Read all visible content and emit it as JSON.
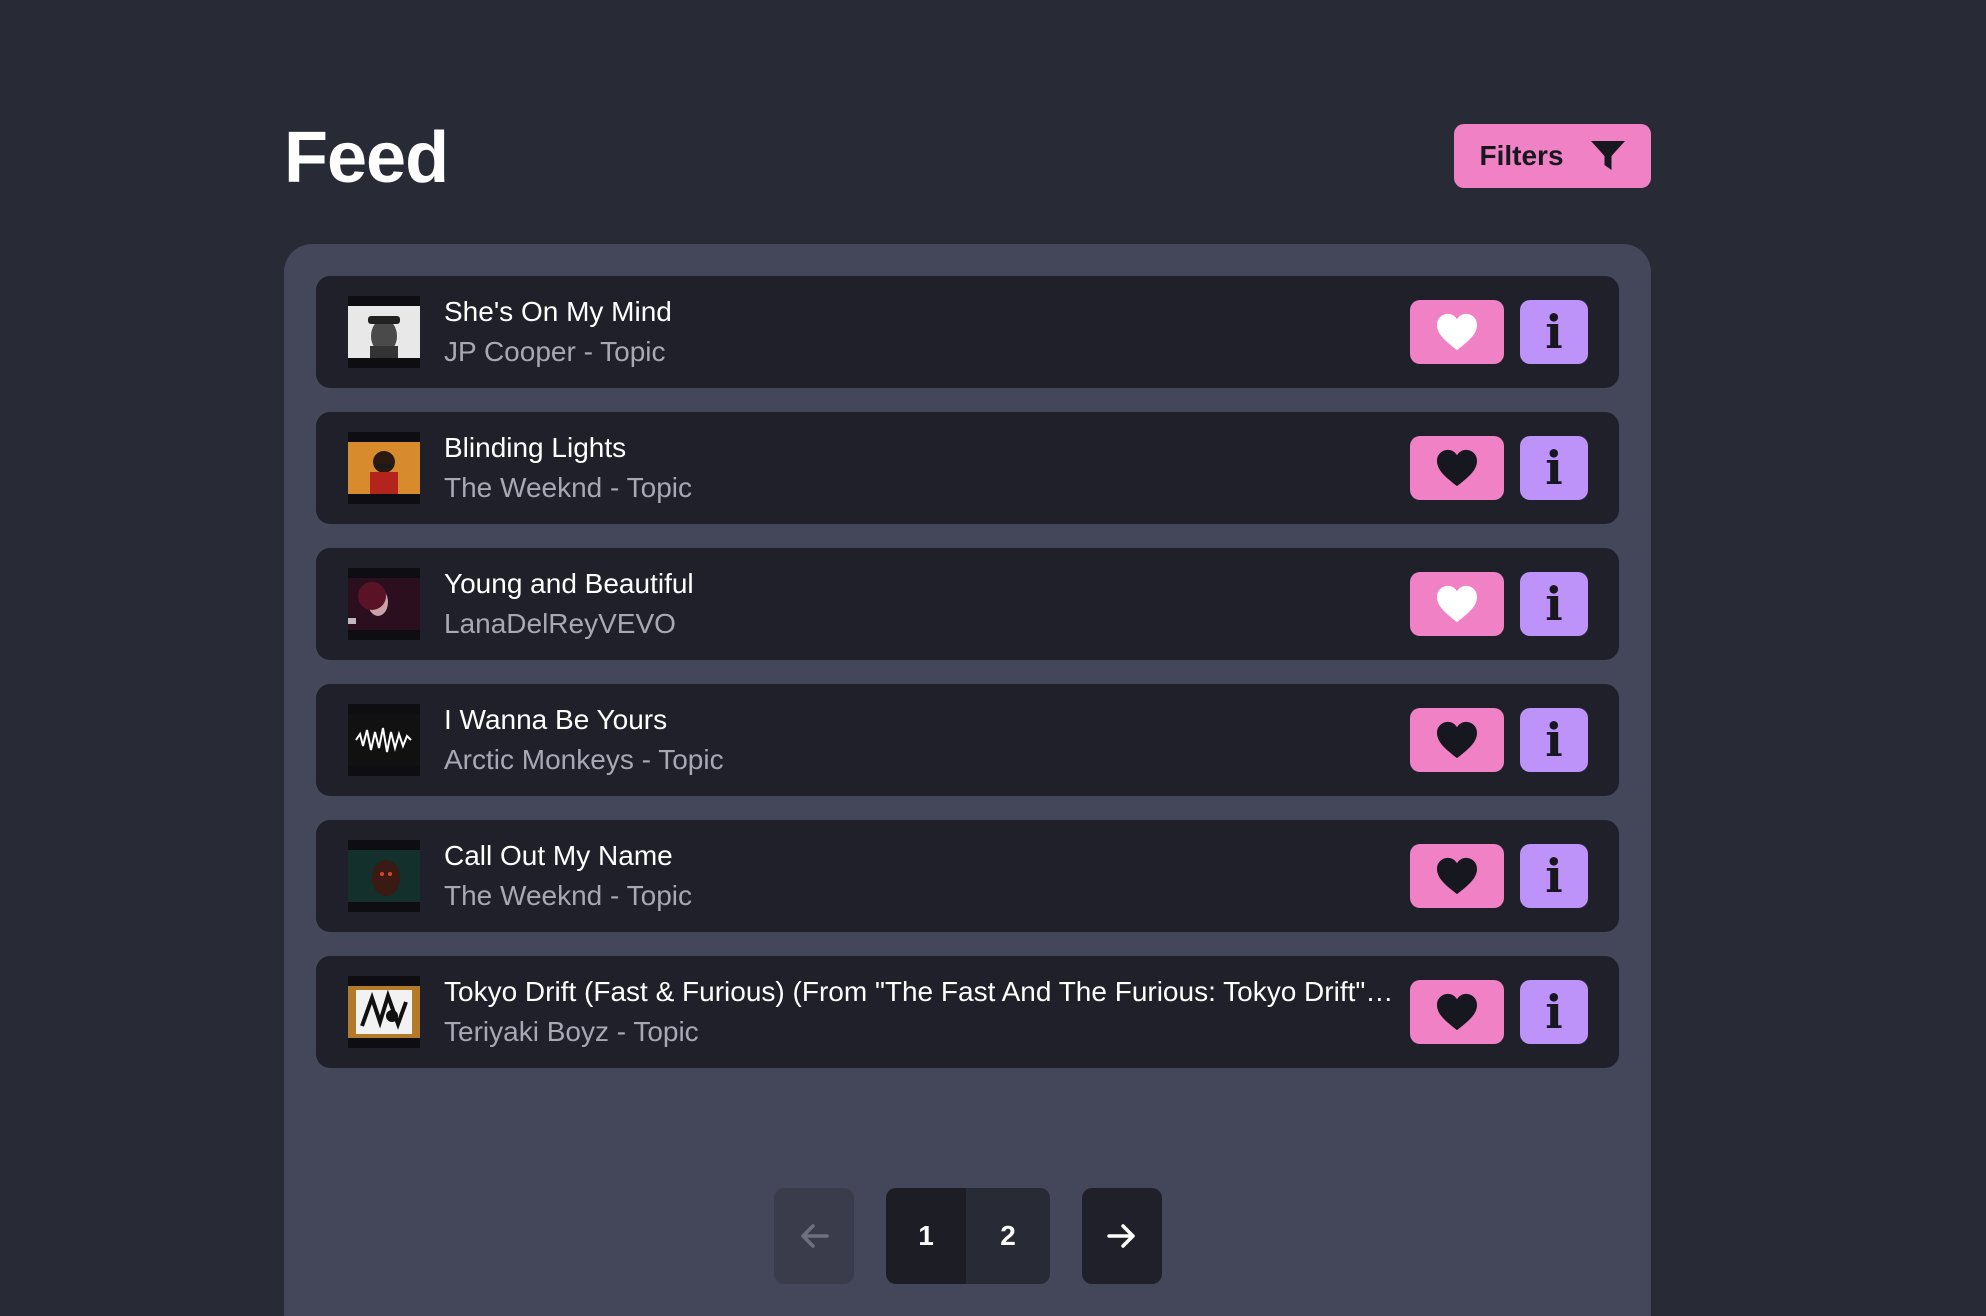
{
  "header": {
    "title": "Feed",
    "filters_label": "Filters",
    "filter_icon": "funnel-icon"
  },
  "colors": {
    "background": "#282a36",
    "panel": "#44475a",
    "row": "#1f2029",
    "like_button": "#f081c4",
    "info_button": "#bd93f9",
    "heart_liked": "#17181f",
    "heart_unliked": "#ffffff"
  },
  "songs": [
    {
      "title": "She's On My Mind",
      "artist": "JP Cooper - Topic",
      "liked": false
    },
    {
      "title": "Blinding Lights",
      "artist": "The Weeknd - Topic",
      "liked": true
    },
    {
      "title": "Young and Beautiful",
      "artist": "LanaDelReyVEVO",
      "liked": false
    },
    {
      "title": "I Wanna Be Yours",
      "artist": "Arctic Monkeys - Topic",
      "liked": true
    },
    {
      "title": "Call Out My Name",
      "artist": "The Weeknd - Topic",
      "liked": true
    },
    {
      "title": "Tokyo Drift (Fast & Furious) (From \"The Fast And The Furious: Tokyo Drift\" Soundtrack)",
      "artist": "Teriyaki Boyz - Topic",
      "liked": true
    }
  ],
  "row_icons": {
    "like": "heart-icon",
    "info": "info-icon",
    "info_glyph": "i"
  },
  "pagination": {
    "prev_icon": "arrow-left-icon",
    "next_icon": "arrow-right-icon",
    "pages": [
      "1",
      "2"
    ],
    "current_page": "1"
  }
}
